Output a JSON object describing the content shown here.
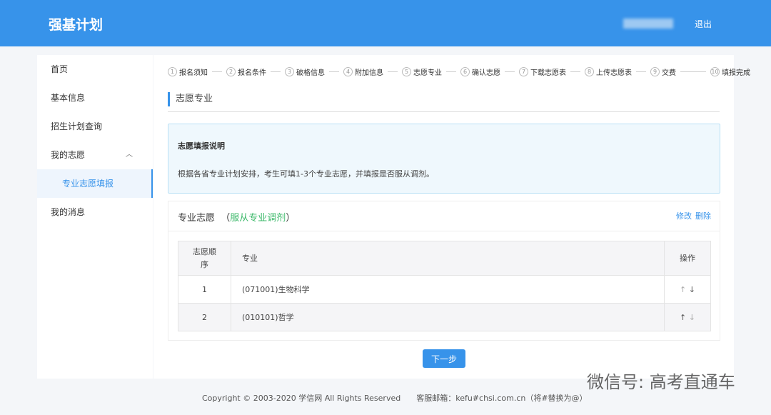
{
  "header": {
    "title": "强基计划",
    "logout": "退出"
  },
  "sidebar": {
    "items": [
      {
        "label": "首页"
      },
      {
        "label": "基本信息"
      },
      {
        "label": "招生计划查询"
      },
      {
        "label": "我的志愿"
      },
      {
        "label": "专业志愿填报"
      },
      {
        "label": "我的消息"
      }
    ]
  },
  "steps": [
    {
      "n": "1",
      "label": "报名须知"
    },
    {
      "n": "2",
      "label": "报名条件"
    },
    {
      "n": "3",
      "label": "破格信息"
    },
    {
      "n": "4",
      "label": "附加信息"
    },
    {
      "n": "5",
      "label": "志愿专业"
    },
    {
      "n": "6",
      "label": "确认志愿"
    },
    {
      "n": "7",
      "label": "下载志愿表"
    },
    {
      "n": "8",
      "label": "上传志愿表"
    },
    {
      "n": "9",
      "label": "交费"
    },
    {
      "n": "10",
      "label": "填报完成"
    }
  ],
  "section_title": "志愿专业",
  "notice": {
    "title": "志愿填报说明",
    "text": "根据各省专业计划安排，考生可填1-3个专业志愿，并填报是否服从调剂。"
  },
  "panel": {
    "title": "专业志愿",
    "open": "（",
    "obey": "服从专业调剂",
    "close": "）",
    "edit": "修改",
    "delete": "删除",
    "columns": [
      "志愿顺序",
      "专业",
      "操作"
    ],
    "rows": [
      {
        "order": "1",
        "major": "(071001)生物科学"
      },
      {
        "order": "2",
        "major": "(010101)哲学"
      }
    ]
  },
  "next": "下一步",
  "footer": {
    "copyright": "Copyright © 2003-2020 学信网 All Rights Reserved",
    "email": "客服邮箱：kefu#chsi.com.cn（将#替换为@）"
  },
  "watermark": "微信号: 高考直通车"
}
